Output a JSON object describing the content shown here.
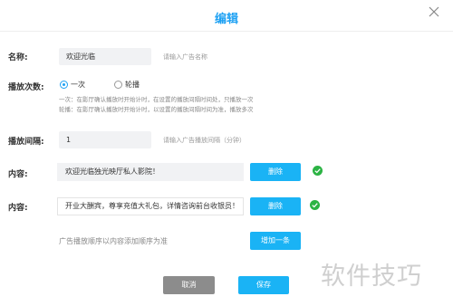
{
  "dialog": {
    "title": "编辑"
  },
  "form": {
    "name": {
      "label": "名称:",
      "value": "欢迎光临",
      "hint": "请输入广告名称"
    },
    "play_count": {
      "label": "播放次数:",
      "options": [
        {
          "label": "一次",
          "selected": true
        },
        {
          "label": "轮播",
          "selected": false
        }
      ],
      "desc_line1": "一次：在影厅确认播放时开始计时，在设置的播放间隔时间处，只播放一次",
      "desc_line2": "轮播：在影厅确认播放时开始计时，以设置的播放间隔时间为准，播放多次"
    },
    "interval": {
      "label": "播放间隔:",
      "value": "1",
      "hint": "请输入广告播放间隔（分钟）"
    },
    "contents": [
      {
        "label": "内容:",
        "value": "欢迎光临独光映厅私人影院！",
        "delete_label": "删除"
      },
      {
        "label": "内容:",
        "value": "开业大酬宾，尊享充值大礼包，详情咨询前台收银员！",
        "delete_label": "删除"
      }
    ],
    "order_note": "广告播放顺序以内容添加顺序为准",
    "add_label": "增加一条"
  },
  "footer": {
    "cancel_label": "取消",
    "save_label": "保存"
  },
  "watermark": "软件技巧",
  "colors": {
    "accent": "#1ea1f3",
    "button": "#1ab3f5",
    "cancel": "#8c8c8c",
    "success": "#2cb344"
  },
  "icons": {
    "close": "close-icon",
    "check": "check-circle-icon"
  }
}
